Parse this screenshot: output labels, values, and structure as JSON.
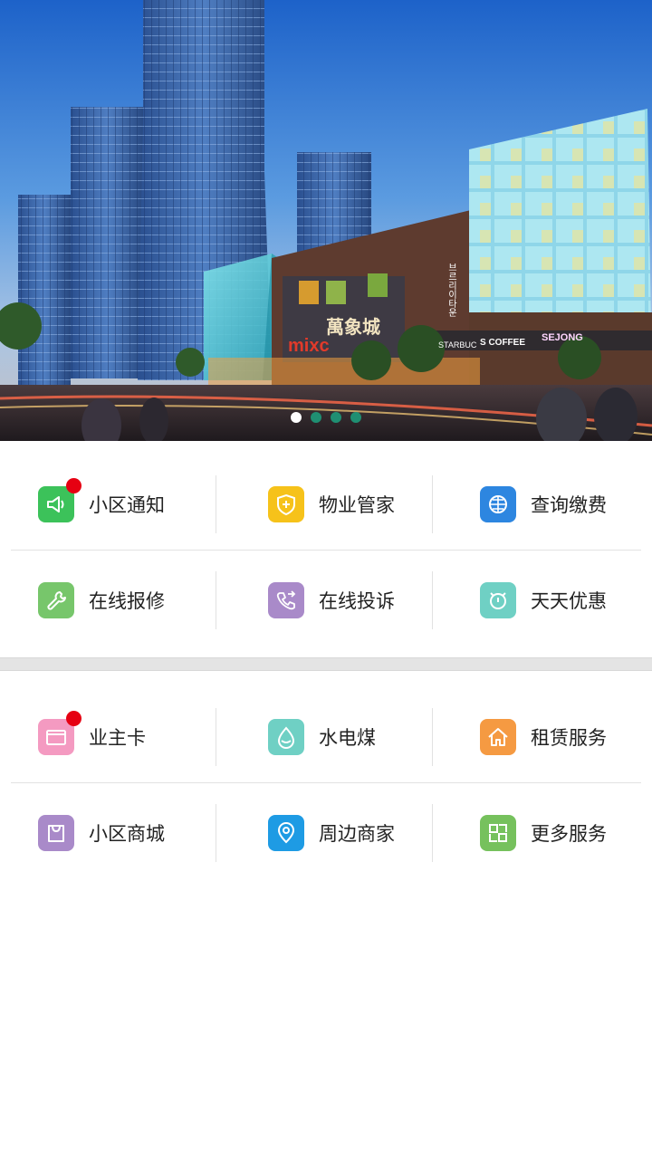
{
  "banner": {
    "image_name": "city-mall-illustration",
    "signs": {
      "mall_logo": "mixc",
      "mall_name": "萬象城",
      "coffee": "S COFFEE",
      "starbucks": "STARBUC",
      "sejong": "SEJONG",
      "korean_vertical": "브르리이타운"
    },
    "carousel": {
      "total": 4,
      "active_index": 0
    }
  },
  "services_group_1": {
    "rows": [
      [
        {
          "label": "小区通知",
          "icon": "speaker-icon",
          "color": "#3cc25a",
          "badge": true
        },
        {
          "label": "物业管家",
          "icon": "shield-plus-icon",
          "color": "#f6c21a",
          "badge": false
        },
        {
          "label": "查询缴费",
          "icon": "globe-icon",
          "color": "#2d86e0",
          "badge": false
        }
      ],
      [
        {
          "label": "在线报修",
          "icon": "wrench-icon",
          "color": "#77c66b",
          "badge": false
        },
        {
          "label": "在线投诉",
          "icon": "phone-transfer-icon",
          "color": "#a98ac9",
          "badge": false
        },
        {
          "label": "天天优惠",
          "icon": "alarm-clock-icon",
          "color": "#6fd0c4",
          "badge": false
        }
      ]
    ]
  },
  "services_group_2": {
    "rows": [
      [
        {
          "label": "业主卡",
          "icon": "card-icon",
          "color": "#f49ac1",
          "badge": true
        },
        {
          "label": "水电煤",
          "icon": "water-drop-icon",
          "color": "#6fd0c4",
          "badge": false
        },
        {
          "label": "租赁服务",
          "icon": "house-icon",
          "color": "#f59a42",
          "badge": false
        }
      ],
      [
        {
          "label": "小区商城",
          "icon": "shopping-bag-icon",
          "color": "#a98ac9",
          "badge": false
        },
        {
          "label": "周边商家",
          "icon": "location-pin-icon",
          "color": "#1e9be4",
          "badge": false
        },
        {
          "label": "更多服务",
          "icon": "grid-more-icon",
          "color": "#76c15d",
          "badge": false
        }
      ]
    ]
  }
}
